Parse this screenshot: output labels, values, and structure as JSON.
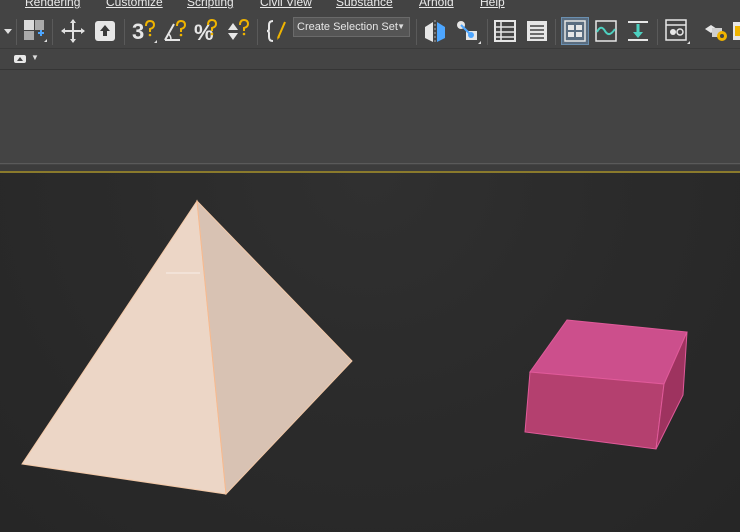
{
  "menubar": {
    "items": [
      "Rendering",
      "Customize",
      "Scripting",
      "Civil View",
      "Substance",
      "Arnold",
      "Help"
    ]
  },
  "toolbar": {
    "selection_set_placeholder": "Create Selection Set",
    "icons": [
      "dropdown-arrow-icon",
      "viewport-layout-icon",
      "move-icon",
      "upload-icon",
      "snap-3d-icon",
      "angle-snap-icon",
      "percent-snap-icon",
      "spinner-snap-icon",
      "edit-named-selection-icon",
      "mirror-icon",
      "align-icon",
      "scene-explorer-icon",
      "layer-explorer-icon",
      "toggle-ribbon-icon",
      "curve-editor-icon",
      "schematic-view-icon",
      "material-editor-icon",
      "render-setup-icon"
    ]
  },
  "scene": {
    "objects": [
      "pyramid",
      "box"
    ],
    "colors": {
      "pyramid_light": "#ecd6c6",
      "pyramid_shade": "#d6c0b1",
      "box_top": "#cc4f8c",
      "box_front": "#b4406f",
      "box_side": "#9e335f",
      "accent": "#8a7a2c"
    }
  }
}
